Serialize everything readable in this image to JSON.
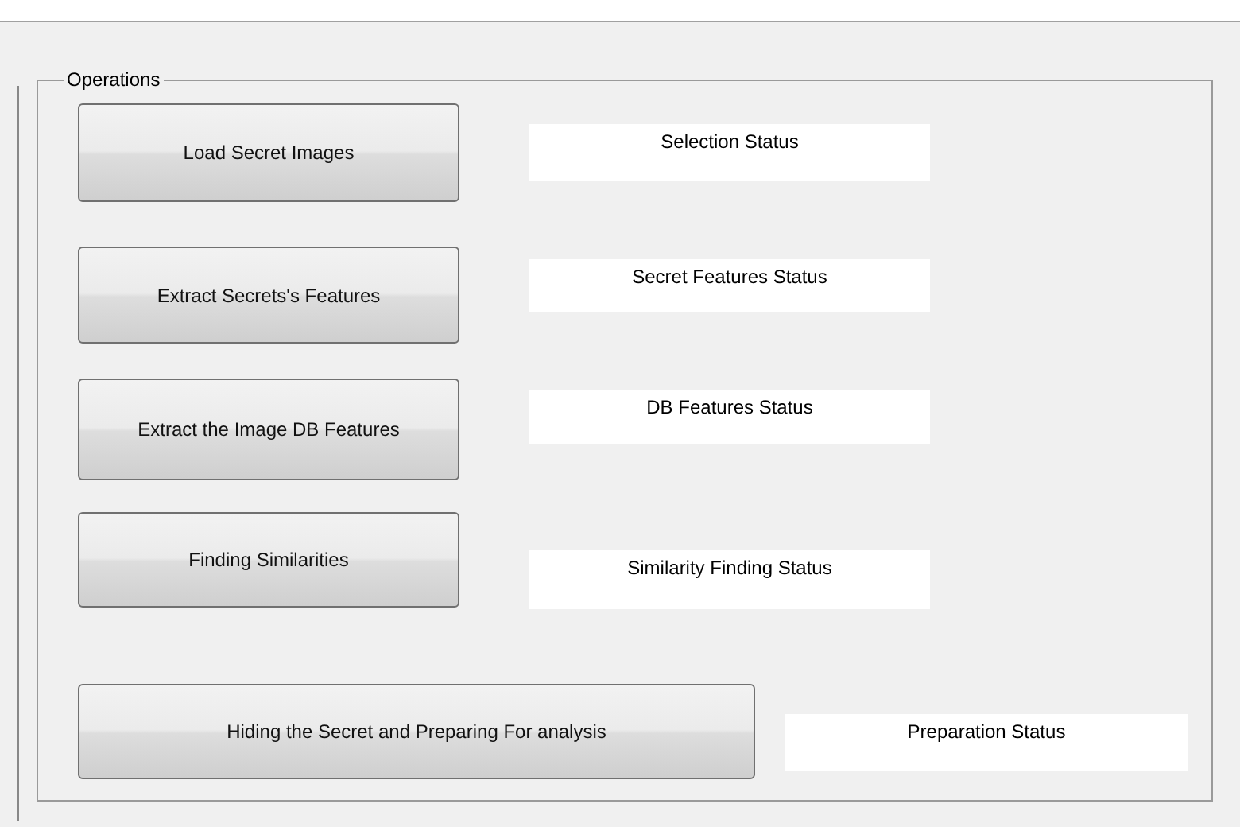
{
  "panel": {
    "title": "Operations",
    "rows": [
      {
        "button": "Load Secret Images",
        "status": "Selection Status"
      },
      {
        "button": "Extract Secrets's Features",
        "status": "Secret Features Status"
      },
      {
        "button": "Extract the Image DB Features",
        "status": "DB Features Status"
      },
      {
        "button": "Finding Similarities",
        "status": "Similarity Finding Status"
      },
      {
        "button": "Hiding the Secret and Preparing For analysis",
        "status": "Preparation Status"
      }
    ]
  }
}
